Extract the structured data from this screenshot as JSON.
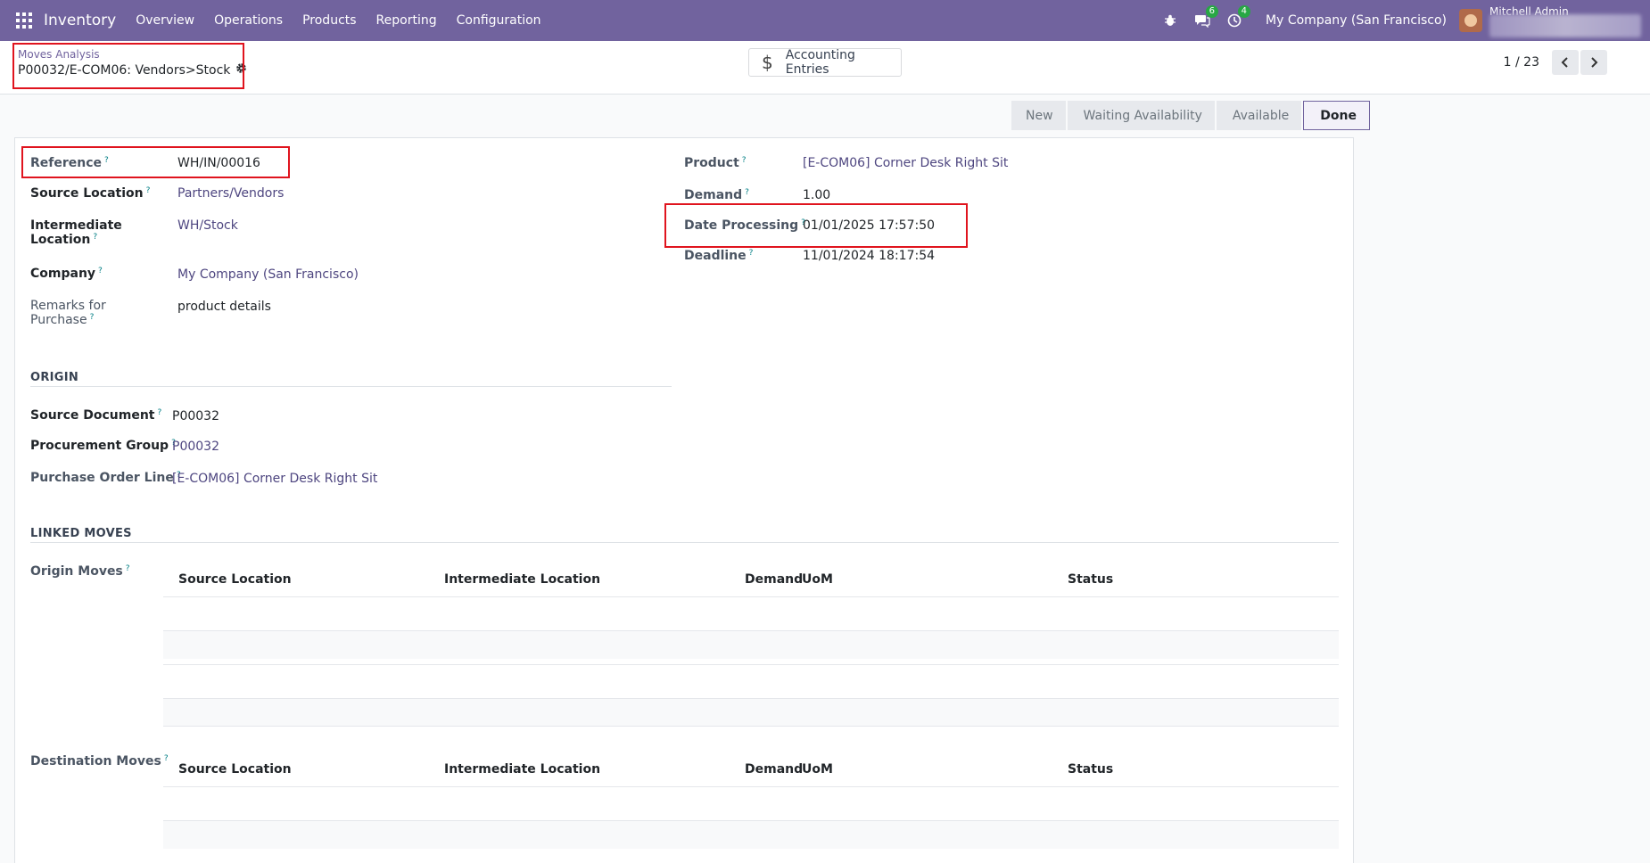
{
  "topbar": {
    "app_name": "Inventory",
    "menu": [
      "Overview",
      "Operations",
      "Products",
      "Reporting",
      "Configuration"
    ],
    "messages_count": "6",
    "activities_count": "4",
    "company": "My Company (San Francisco)",
    "user": "Mitchell Admin"
  },
  "breadcrumb": {
    "parent": "Moves Analysis",
    "current": "P00032/E-COM06: Vendors>Stock"
  },
  "smart_button": {
    "label": "Accounting Entries",
    "icon": "dollar-icon"
  },
  "pager": {
    "text": "1 / 23"
  },
  "statusbar": [
    "New",
    "Waiting Availability",
    "Available",
    "Done"
  ],
  "statusbar_active": "Done",
  "left_fields": {
    "reference_label": "Reference",
    "reference_value": "WH/IN/00016",
    "source_location_label": "Source Location",
    "source_location_value": "Partners/Vendors",
    "intermediate_label_1": "Intermediate",
    "intermediate_label_2": "Location",
    "intermediate_value": "WH/Stock",
    "company_label": "Company",
    "company_value": "My Company (San Francisco)",
    "remarks_label_1": "Remarks for",
    "remarks_label_2": "Purchase",
    "remarks_value": "product details"
  },
  "right_fields": {
    "product_label": "Product",
    "product_value": "[E-COM06] Corner Desk Right Sit",
    "demand_label": "Demand",
    "demand_value": "1.00",
    "date_processing_label": "Date Processing",
    "date_processing_value": "01/01/2025 17:57:50",
    "deadline_label": "Deadline",
    "deadline_value": "11/01/2024 18:17:54"
  },
  "origin": {
    "title": "ORIGIN",
    "source_document_label": "Source Document",
    "source_document_value": "P00032",
    "procurement_group_label": "Procurement Group",
    "procurement_group_value": "P00032",
    "po_line_label": "Purchase Order Line",
    "po_line_value": "[E-COM06] Corner Desk Right Sit"
  },
  "linked_moves": {
    "title": "LINKED MOVES",
    "origin_moves_label": "Origin Moves",
    "destination_moves_label": "Destination Moves",
    "columns": [
      "Source Location",
      "Intermediate Location",
      "Demand",
      "UoM",
      "Status"
    ]
  }
}
